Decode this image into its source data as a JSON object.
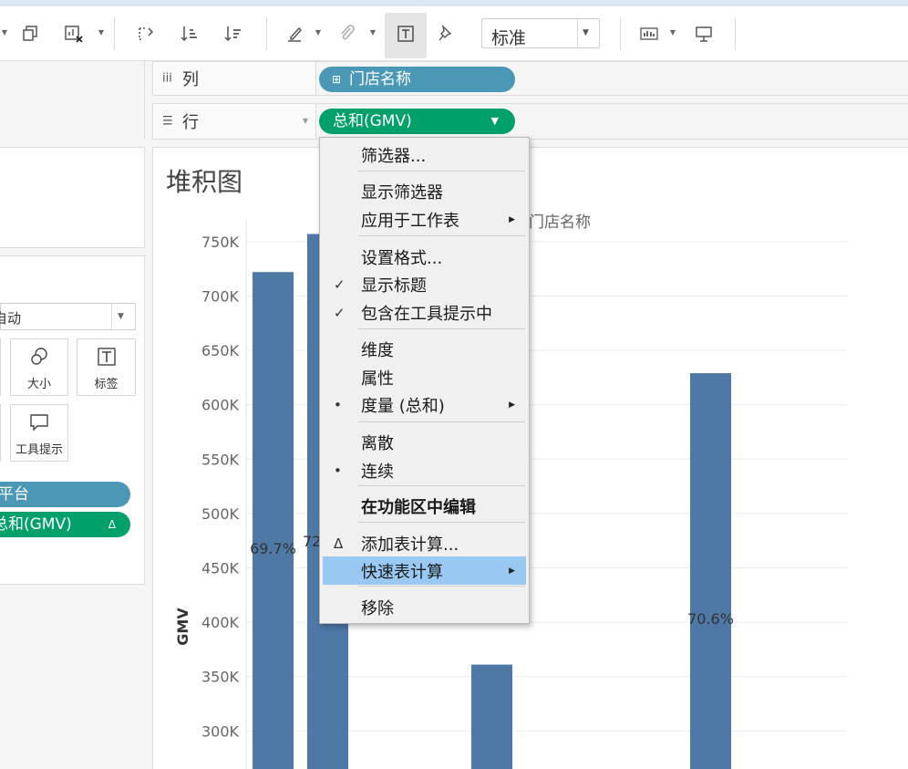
{
  "toolbar": {
    "icons": [
      "duplicate-sheet-icon",
      "clear-sheet-icon",
      "swap-axes-icon",
      "sort-ascending-icon",
      "sort-descending-icon",
      "highlight-icon",
      "group-members-icon",
      "show-mark-labels-icon",
      "pin-icon",
      "show-me-icon",
      "presentation-mode-icon"
    ],
    "fit_select": "标准"
  },
  "shelves": {
    "columns": {
      "label": "列",
      "pill": "门店名称"
    },
    "rows": {
      "label": "行",
      "pill": "总和(GMV)"
    }
  },
  "marks": {
    "type_value": "自动",
    "buttons": [
      {
        "label": "大小",
        "icon": "size-icon"
      },
      {
        "label": "标签",
        "icon": "label-icon"
      },
      {
        "label": "工具提示",
        "icon": "tooltip-icon"
      }
    ],
    "pills": [
      {
        "label": "平台",
        "color": "#4a98b6"
      },
      {
        "label": "总和(GMV)",
        "color": "#00a06a",
        "badge": "Δ"
      }
    ]
  },
  "sheet": {
    "title": "堆积图",
    "column_header": "门店名称"
  },
  "context_menu": {
    "items": [
      {
        "label": "筛选器...",
        "check": "",
        "submenu": false
      },
      {
        "label": "显示筛选器",
        "check": "",
        "submenu": false
      },
      {
        "label": "应用于工作表",
        "check": "",
        "submenu": true
      },
      {
        "label": "设置格式...",
        "check": "",
        "submenu": false
      },
      {
        "label": "显示标题",
        "check": "✓",
        "submenu": false
      },
      {
        "label": "包含在工具提示中",
        "check": "✓",
        "submenu": false
      },
      {
        "label": "维度",
        "check": "",
        "submenu": false
      },
      {
        "label": "属性",
        "check": "",
        "submenu": false
      },
      {
        "label": "度量 (总和)",
        "check": "•",
        "submenu": true
      },
      {
        "label": "离散",
        "check": "",
        "submenu": false
      },
      {
        "label": "连续",
        "check": "•",
        "submenu": false
      },
      {
        "label": "在功能区中编辑",
        "check": "",
        "submenu": false,
        "bold": true
      },
      {
        "label": "添加表计算...",
        "check": "Δ",
        "submenu": false
      },
      {
        "label": "快速表计算",
        "check": "",
        "submenu": true,
        "highlighted": true
      },
      {
        "label": "移除",
        "check": "",
        "submenu": false
      }
    ]
  },
  "chart_data": {
    "type": "bar",
    "title": "堆积图",
    "xlabel": "门店名称",
    "ylabel": "GMV",
    "ylim": [
      265000,
      770000
    ],
    "yticks": [
      "750K",
      "700K",
      "650K",
      "600K",
      "550K",
      "500K",
      "450K",
      "400K",
      "350K",
      "300K"
    ],
    "bar_color": "#4e79a7",
    "categories": [
      "",
      "",
      "",
      "",
      "",
      "",
      "",
      "",
      "",
      ""
    ],
    "values": [
      722000,
      757000,
      null,
      null,
      361000,
      null,
      null,
      null,
      629000,
      null
    ],
    "data_labels": [
      "69.7%",
      "72",
      "",
      "",
      "",
      "",
      "",
      "",
      "70.6%",
      ""
    ]
  }
}
